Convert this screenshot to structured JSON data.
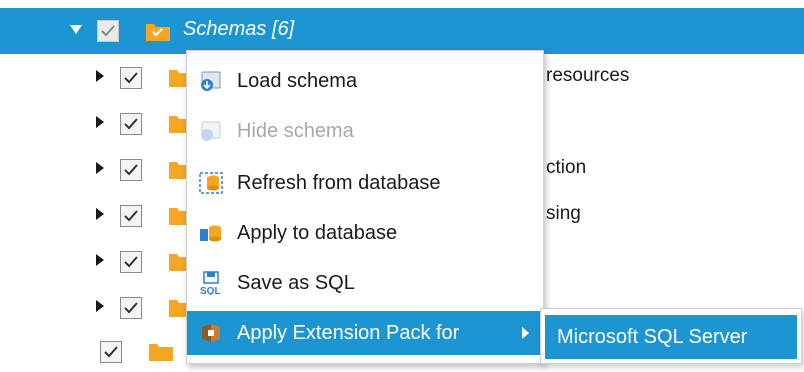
{
  "tree": {
    "header": {
      "label": "Schemas [6]"
    },
    "rows": [
      {
        "label": "resources"
      },
      {
        "label": ""
      },
      {
        "label": "ction"
      },
      {
        "label": "sing"
      },
      {
        "label": ""
      },
      {
        "label": ""
      },
      {
        "label": ""
      }
    ]
  },
  "context_menu": {
    "items": [
      {
        "label": "Load schema",
        "icon": "load-schema-icon",
        "enabled": true
      },
      {
        "label": "Hide schema",
        "icon": "hide-schema-icon",
        "enabled": false
      },
      {
        "label": "Refresh from database",
        "icon": "refresh-database-icon",
        "enabled": true
      },
      {
        "label": "Apply to database",
        "icon": "apply-database-icon",
        "enabled": true
      },
      {
        "label": "Save as SQL",
        "icon": "save-sql-icon",
        "enabled": true
      },
      {
        "label": "Apply Extension Pack for",
        "icon": "extension-pack-icon",
        "enabled": true,
        "has_submenu": true
      }
    ]
  },
  "submenu": {
    "items": [
      {
        "label": "Microsoft SQL Server"
      }
    ]
  },
  "colors": {
    "selection": "#1e95d3",
    "folder": "#f5a623"
  }
}
